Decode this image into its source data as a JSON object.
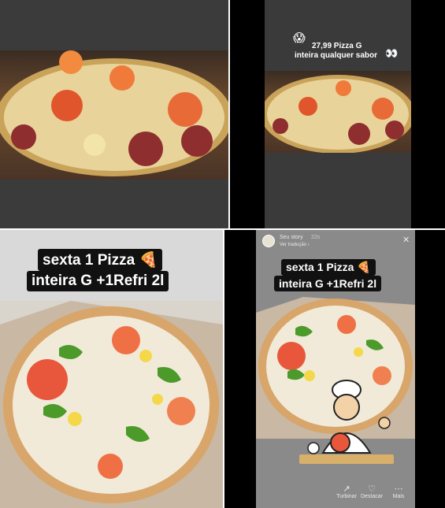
{
  "panel_top_right": {
    "caption_line1": "27,99 Pizza G",
    "caption_line2": "inteira qualquer sabor",
    "emoji_left": "😱",
    "emoji_right": "👀"
  },
  "panel_bottom_left": {
    "headline_line1": "sexta 1 Pizza 🍕",
    "headline_line2": "inteira G +1Refri 2l"
  },
  "panel_bottom_right": {
    "story_owner": "Seu story",
    "story_time": "22s",
    "translate_link": "Ver tradução ›",
    "headline_line1": "sexta 1 Pizza 🍕",
    "headline_line2": "inteira G +1Refri 2l",
    "close_glyph": "✕",
    "actions": [
      {
        "icon": "trending-icon",
        "glyph": "↗",
        "label": "Turbinar"
      },
      {
        "icon": "highlight-icon",
        "glyph": "♡",
        "label": "Destacar"
      },
      {
        "icon": "more-icon",
        "glyph": "⋯",
        "label": "Mais"
      }
    ]
  }
}
